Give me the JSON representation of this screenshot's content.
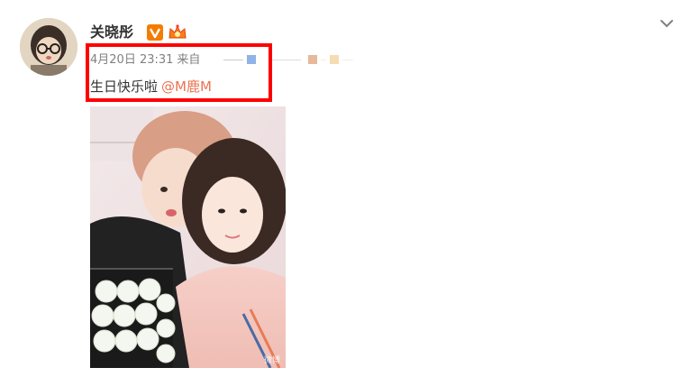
{
  "post": {
    "author": "关晓彤",
    "verified_icon": "verified-v-badge-icon",
    "member_icon": "crown-badge-icon",
    "timestamp": "4月20日 23:31",
    "source_label": "来自",
    "text": "生日快乐啦",
    "mention": "@M鹿M",
    "menu_icon": "chevron-down-icon",
    "photo_watermark": "微博"
  },
  "colors": {
    "accent_mention": "#eb7350",
    "highlight_box": "#ff0000",
    "meta_gray": "#808080",
    "verified_orange": "#f57c00"
  }
}
